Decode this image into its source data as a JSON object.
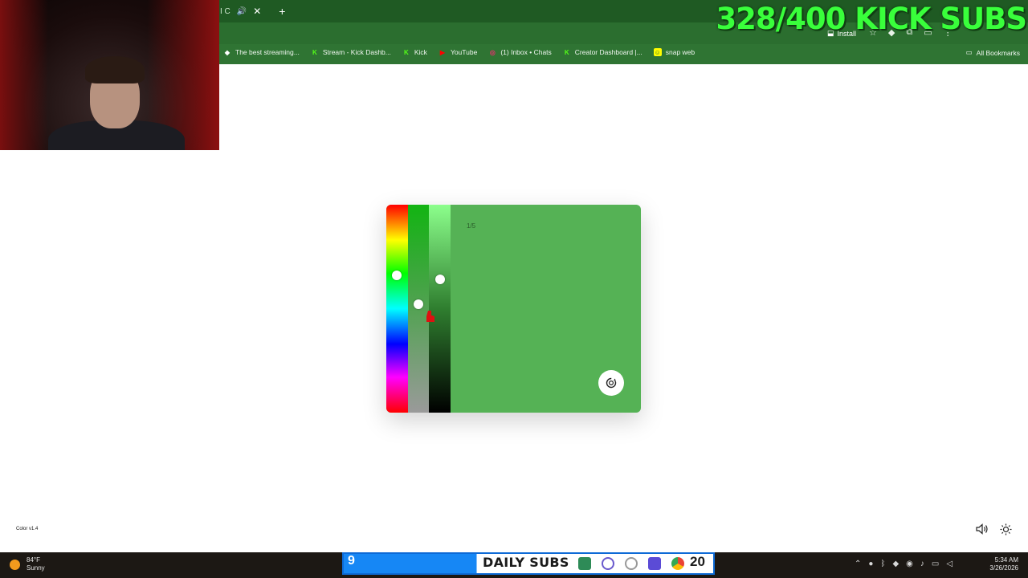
{
  "browser": {
    "tab_fragment": "I C",
    "install_label": "Install",
    "bookmarks": [
      {
        "label": "The best streaming...",
        "icon": "kick-like-diamond-icon",
        "color": "#ffffff"
      },
      {
        "label": "Stream - Kick Dashb...",
        "icon": "kick-icon",
        "color": "#53fc18"
      },
      {
        "label": "Kick",
        "icon": "kick-icon",
        "color": "#53fc18"
      },
      {
        "label": "YouTube",
        "icon": "youtube-icon",
        "color": "#ff0000"
      },
      {
        "label": "(1) Inbox • Chats",
        "icon": "instagram-icon",
        "color": "#e1306c"
      },
      {
        "label": "Creator Dashboard |...",
        "icon": "kick-icon",
        "color": "#53fc18"
      },
      {
        "label": "snap web",
        "icon": "snapchat-icon",
        "color": "#fffc00"
      }
    ],
    "all_bookmarks_label": "All Bookmarks"
  },
  "overlay": {
    "subs_goal": "328/400 KICK SUBS",
    "subs_goal_color": "#39ff3b"
  },
  "color_app": {
    "counter": "1/5",
    "background_color": "#55b255",
    "version": "Color v1.4",
    "hue_level": 0.34,
    "saturation_level": 0.48,
    "lightness_level": 0.36
  },
  "taskbar": {
    "temperature": "84°F",
    "condition": "Sunny",
    "daily_subs_count": "9",
    "daily_subs_label": "DAILY SUBS",
    "daily_subs_goal": "20",
    "time": "5:34 AM",
    "date": "3/26/2026"
  }
}
